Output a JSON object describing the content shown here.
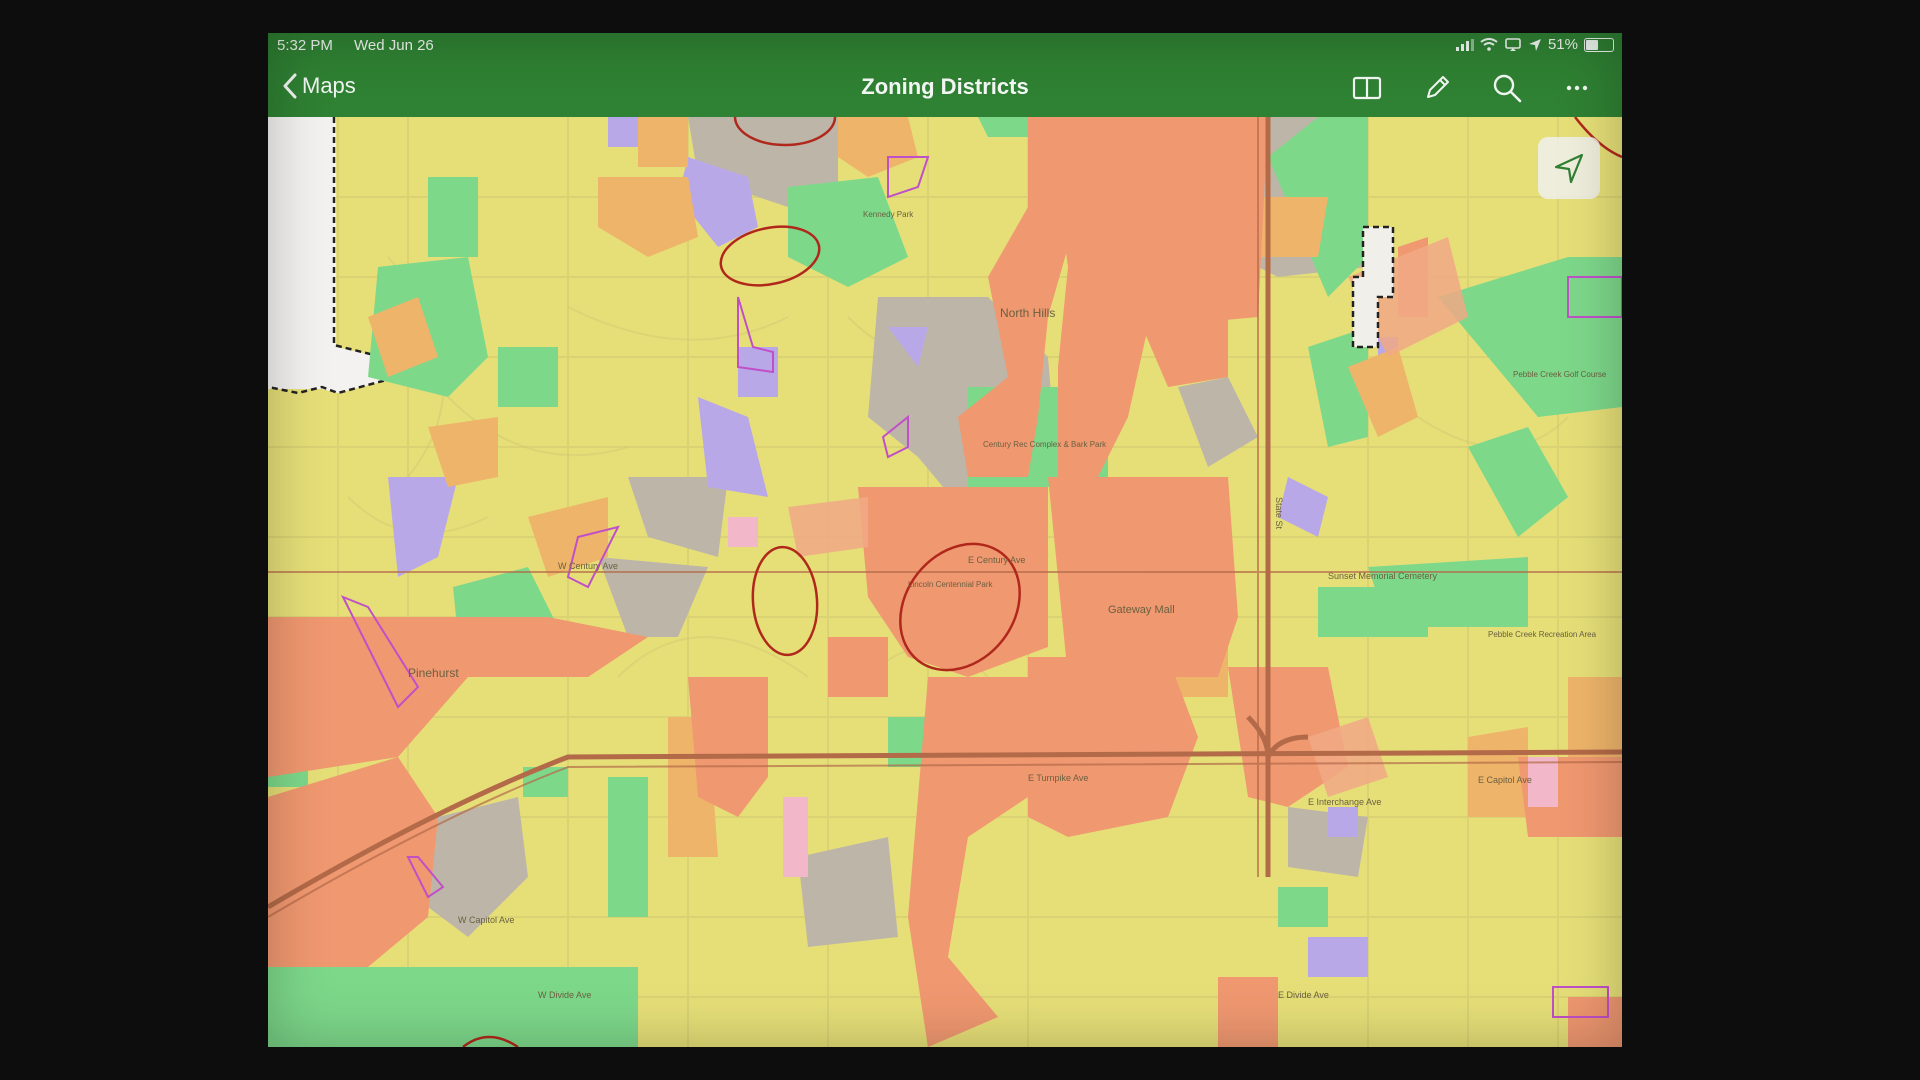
{
  "status_bar": {
    "time": "5:32 PM",
    "date": "Wed Jun 26",
    "battery": "51%",
    "battery_level": 0.51
  },
  "nav_bar": {
    "back_label": "Maps",
    "title": "Zoning Districts",
    "tool_icons": [
      "book-icon",
      "pencil-icon",
      "search-icon",
      "more-icon"
    ]
  },
  "map": {
    "labels": {
      "north_hills": "North Hills",
      "pinehurst": "Pinehurst",
      "gateway_mall": "Gateway Mall",
      "sunset_memorial_cemetery": "Sunset Memorial Cemetery",
      "pebble_creek_golf_course": "Pebble Creek Golf Course",
      "pebble_creek_recreation_area": "Pebble Creek Recreation Area",
      "kennedy_park": "Kennedy Park",
      "century_rec_complex": "Century Rec Complex & Bark Park",
      "lincoln_centennial_park": "Lincoln Centennial Park",
      "state_st": "State St",
      "e_capitol_ave": "E Capitol Ave",
      "e_divide_ave": "E Divide Ave",
      "w_divide_ave": "W Divide Ave",
      "e_century_ave": "E Century Ave",
      "w_century_ave": "W Century Ave",
      "e_turnpike_ave": "E Turnpike Ave",
      "e_interchange_ave": "E Interchange Ave",
      "w_capitol_ave": "W Capitol Ave"
    },
    "colors": {
      "residential": "#e6df78",
      "commercial": "#f09870",
      "industrial_orange": "#eeb46a",
      "gray_residential": "#bdb6a8",
      "park": "#7dd88a",
      "public": "#b9a8e8",
      "annotation_red": "#b0281c"
    }
  }
}
